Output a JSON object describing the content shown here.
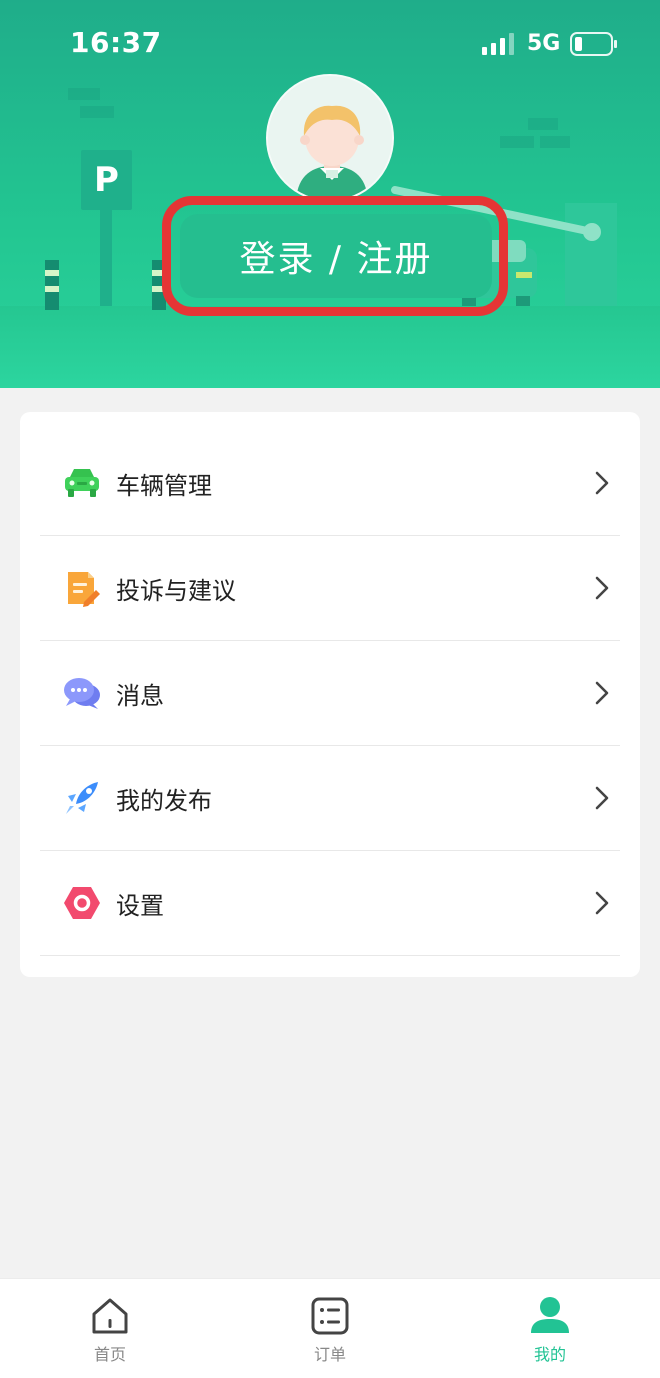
{
  "status_bar": {
    "time": "16:37",
    "network": "5G",
    "icons": [
      "signal-icon",
      "battery-icon"
    ]
  },
  "header": {
    "avatar_icon": "avatar-illustration",
    "login_button_label": "登录 / 注册",
    "parking_sign_letter": "P",
    "highlight_color": "#e53535"
  },
  "menu": {
    "items": [
      {
        "label": "车辆管理",
        "icon": "car-icon"
      },
      {
        "label": "投诉与建议",
        "icon": "complaint-note-icon"
      },
      {
        "label": "消息",
        "icon": "message-bubble-icon"
      },
      {
        "label": "我的发布",
        "icon": "rocket-icon"
      },
      {
        "label": "设置",
        "icon": "settings-hexagon-icon"
      }
    ]
  },
  "tab_bar": {
    "tabs": [
      {
        "label": "首页",
        "icon": "home-icon",
        "active": false
      },
      {
        "label": "订单",
        "icon": "order-list-icon",
        "active": false
      },
      {
        "label": "我的",
        "icon": "profile-icon",
        "active": true
      }
    ]
  },
  "colors": {
    "primary": "#22c394",
    "header_top": "#1fad8a",
    "header_bottom": "#2bd39c",
    "background": "#f2f2f2"
  }
}
